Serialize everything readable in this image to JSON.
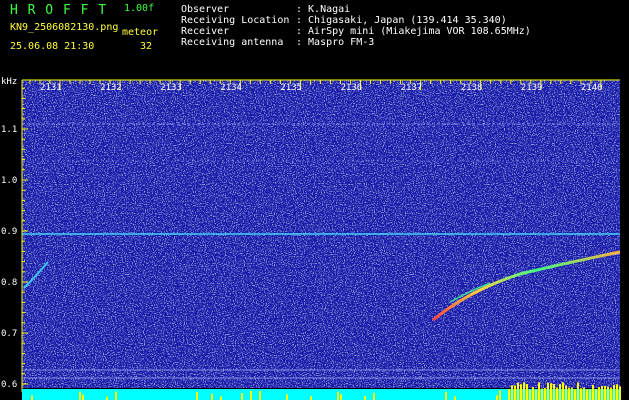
{
  "header": {
    "app_title": "H R O F F T",
    "version": "1.00f",
    "filename": "KN9_2506082130.png",
    "mode_label": "meteor",
    "datetime": "25.06.08 21:30",
    "count": "32"
  },
  "info": [
    {
      "label": "Observer",
      "value": ": K.Nagai"
    },
    {
      "label": "Receiving Location",
      "value": ": Chigasaki, Japan (139.414 35.340)"
    },
    {
      "label": "Receiver",
      "value": ": AirSpy mini (Miakejima VOR 108.65MHz)"
    },
    {
      "label": "Receiving antenna",
      "value": ": Maspro FM-3"
    }
  ],
  "plot": {
    "y_unit": "kHz",
    "x_ticks": [
      "2131",
      "2132",
      "2133",
      "2134",
      "2135",
      "2136",
      "2137",
      "2138",
      "2139",
      "2140"
    ],
    "y_ticks": [
      "1.1",
      "1.0",
      "0.9",
      "0.8",
      "0.7",
      "0.6"
    ],
    "colors": {
      "background": "#1a1aa8",
      "grid": "#ffff00",
      "text": "#ffffff",
      "baseline": "#00ffff",
      "peak": "#ffff00"
    }
  }
}
